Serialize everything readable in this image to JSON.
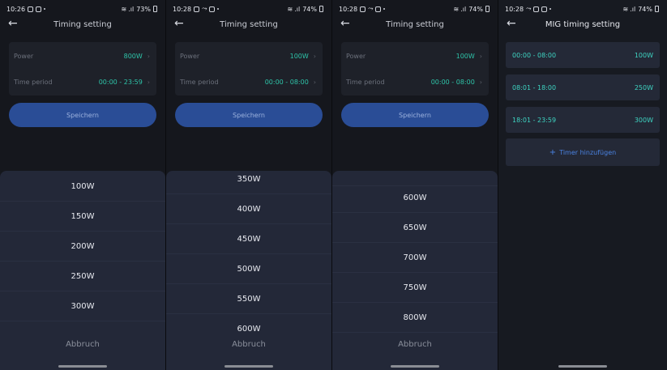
{
  "screens": [
    {
      "status": {
        "time": "10:26",
        "battery": "73%"
      },
      "title": "Timing setting",
      "power_label": "Power",
      "power_value": "800W",
      "period_label": "Time period",
      "period_value": "00:00 - 23:59",
      "save_label": "Speichern",
      "options": [
        "100W",
        "150W",
        "200W",
        "250W",
        "300W"
      ],
      "cancel_label": "Abbruch"
    },
    {
      "status": {
        "time": "10:28",
        "battery": "74%"
      },
      "title": "Timing setting",
      "power_label": "Power",
      "power_value": "100W",
      "period_label": "Time period",
      "period_value": "00:00 - 08:00",
      "save_label": "Speichern",
      "options": [
        "350W",
        "400W",
        "450W",
        "500W",
        "550W",
        "600W"
      ],
      "cancel_label": "Abbruch"
    },
    {
      "status": {
        "time": "10:28",
        "battery": "74%"
      },
      "title": "Timing setting",
      "power_label": "Power",
      "power_value": "100W",
      "period_label": "Time period",
      "period_value": "00:00 - 08:00",
      "save_label": "Speichern",
      "options": [
        "600W",
        "650W",
        "700W",
        "750W",
        "800W"
      ],
      "cancel_label": "Abbruch"
    }
  ],
  "mig": {
    "status": {
      "time": "10:28",
      "battery": "74%"
    },
    "title": "MIG timing setting",
    "timers": [
      {
        "period": "00:00 - 08:00",
        "power": "100W"
      },
      {
        "period": "08:01 - 18:00",
        "power": "250W"
      },
      {
        "period": "18:01 - 23:59",
        "power": "300W"
      }
    ],
    "add_label": "Timer hinzufügen"
  }
}
